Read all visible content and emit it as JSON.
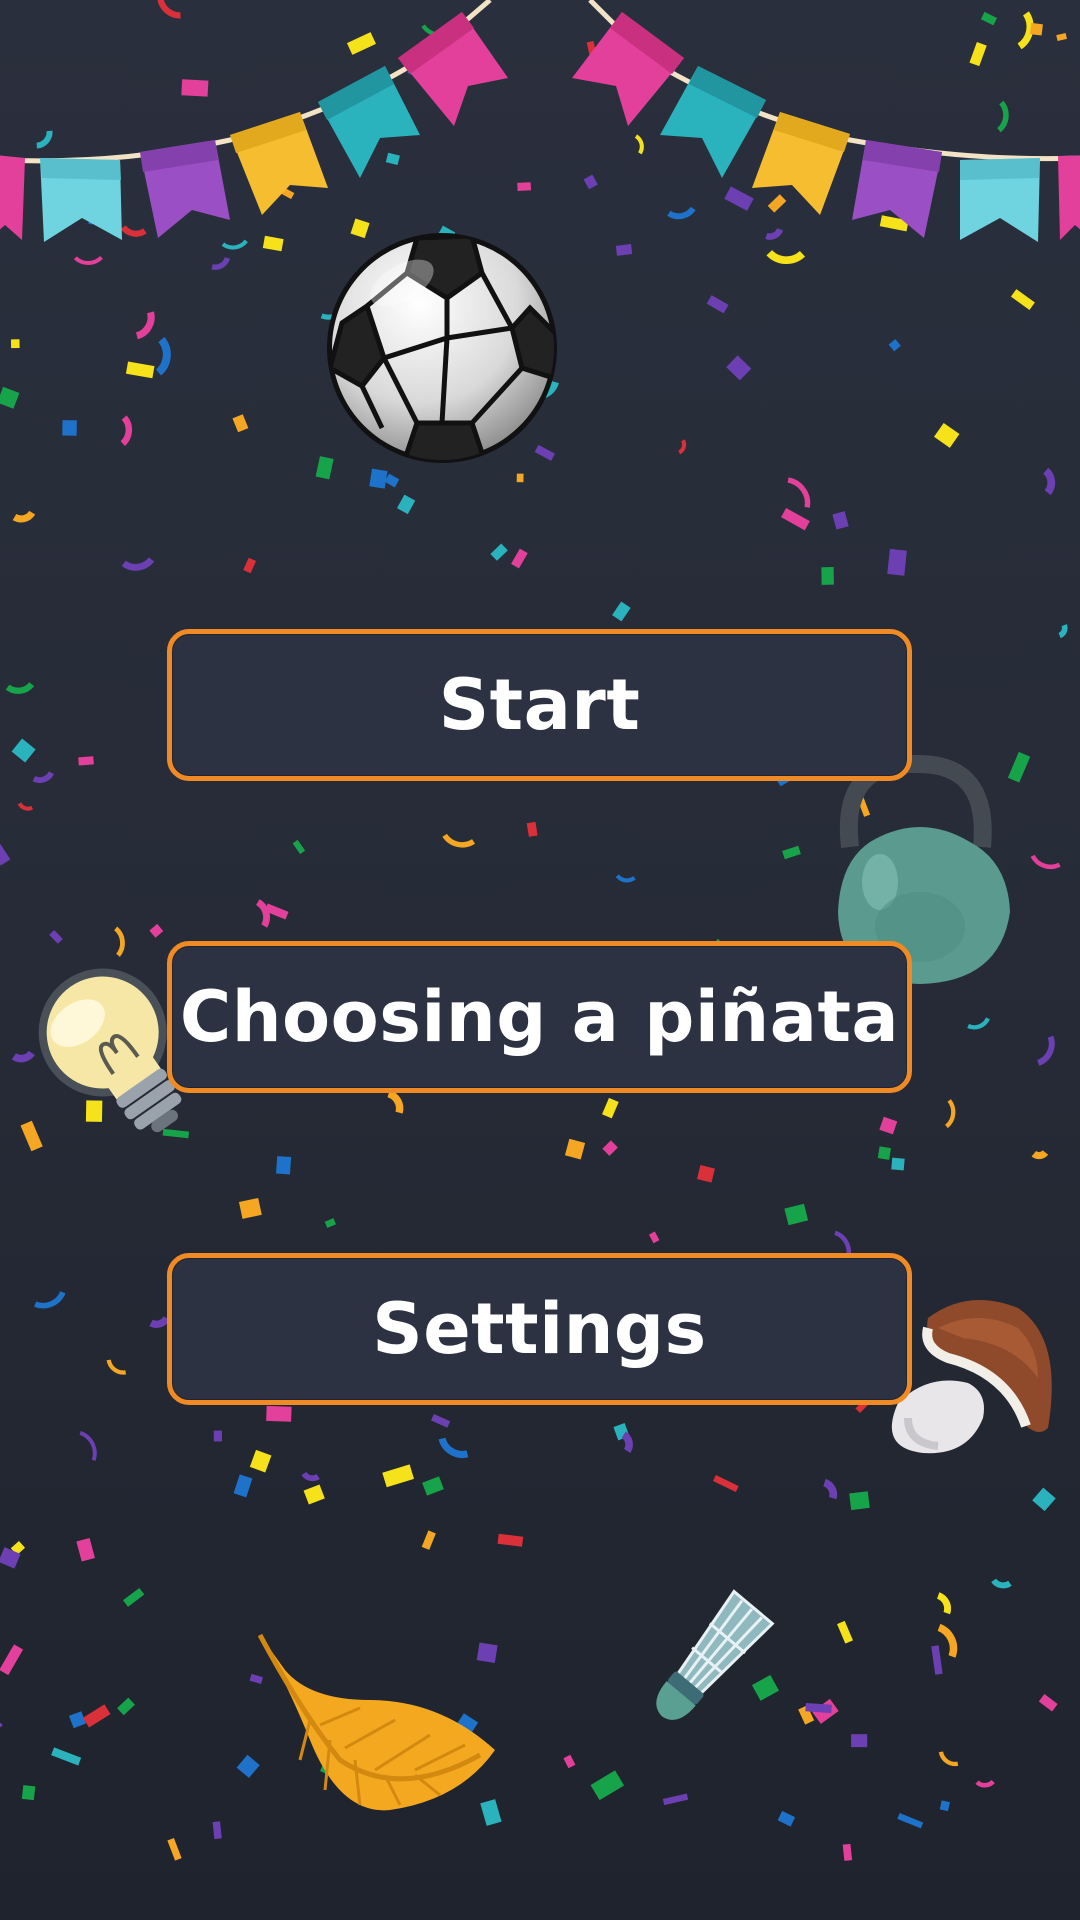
{
  "screen": "main-menu",
  "menu": {
    "buttons": [
      {
        "id": "start",
        "label": "Start"
      },
      {
        "id": "choose-pinata",
        "label": "Choosing a piñata"
      },
      {
        "id": "settings",
        "label": "Settings"
      }
    ]
  },
  "colors": {
    "background": "#262b37",
    "button_fill": "#2c3242",
    "button_border": "#f08a24",
    "button_text": "#ffffff",
    "bunting": [
      "#e2409a",
      "#2bb3bd",
      "#f7bd30",
      "#9b4fc4",
      "#6fd3e0"
    ]
  },
  "decorations": [
    "bunting-garland-icon",
    "soccer-ball-icon",
    "kettlebell-icon",
    "lightbulb-icon",
    "mushroom-icon",
    "leaf-icon",
    "shuttlecock-icon",
    "confetti"
  ]
}
